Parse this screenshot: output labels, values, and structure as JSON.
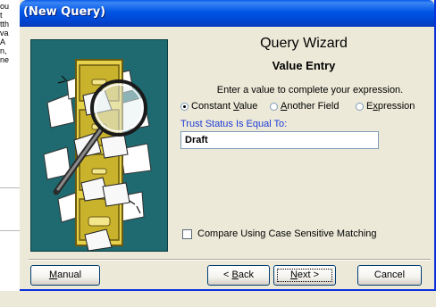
{
  "background_window": {
    "fragments": [
      "ou",
      "t",
      "tth",
      "va",
      "A",
      "n,",
      "ne"
    ]
  },
  "window": {
    "title": "(New Query)"
  },
  "wizard": {
    "heading": "Query Wizard",
    "subheading": "Value Entry",
    "instruction": "Enter a value to complete your expression."
  },
  "options": {
    "selected": "constant",
    "constant": {
      "pre": "Constant ",
      "key": "V",
      "post": "alue"
    },
    "another_field": {
      "pre": "",
      "key": "A",
      "post": "nother Field"
    },
    "expression": {
      "pre": "E",
      "key": "x",
      "post": "pression"
    }
  },
  "value_field": {
    "label": "Trust Status Is Equal To:",
    "value": "Draft"
  },
  "case_sensitive": {
    "label": "Compare Using Case Sensitive Matching",
    "checked": false
  },
  "buttons": {
    "manual": {
      "pre": "",
      "key": "M",
      "post": "anual"
    },
    "back": {
      "pre": "< ",
      "key": "B",
      "post": "ack"
    },
    "next": {
      "pre": "",
      "key": "N",
      "post": "ext >"
    },
    "cancel": "Cancel"
  },
  "colors": {
    "titlebar": "#0055e5",
    "panel_bg": "#1e6a70",
    "dialog_bg": "#ece9d8",
    "field_label": "#1f3bd6"
  },
  "icons": {
    "art": "filing-cabinet-magnifier-illustration"
  }
}
